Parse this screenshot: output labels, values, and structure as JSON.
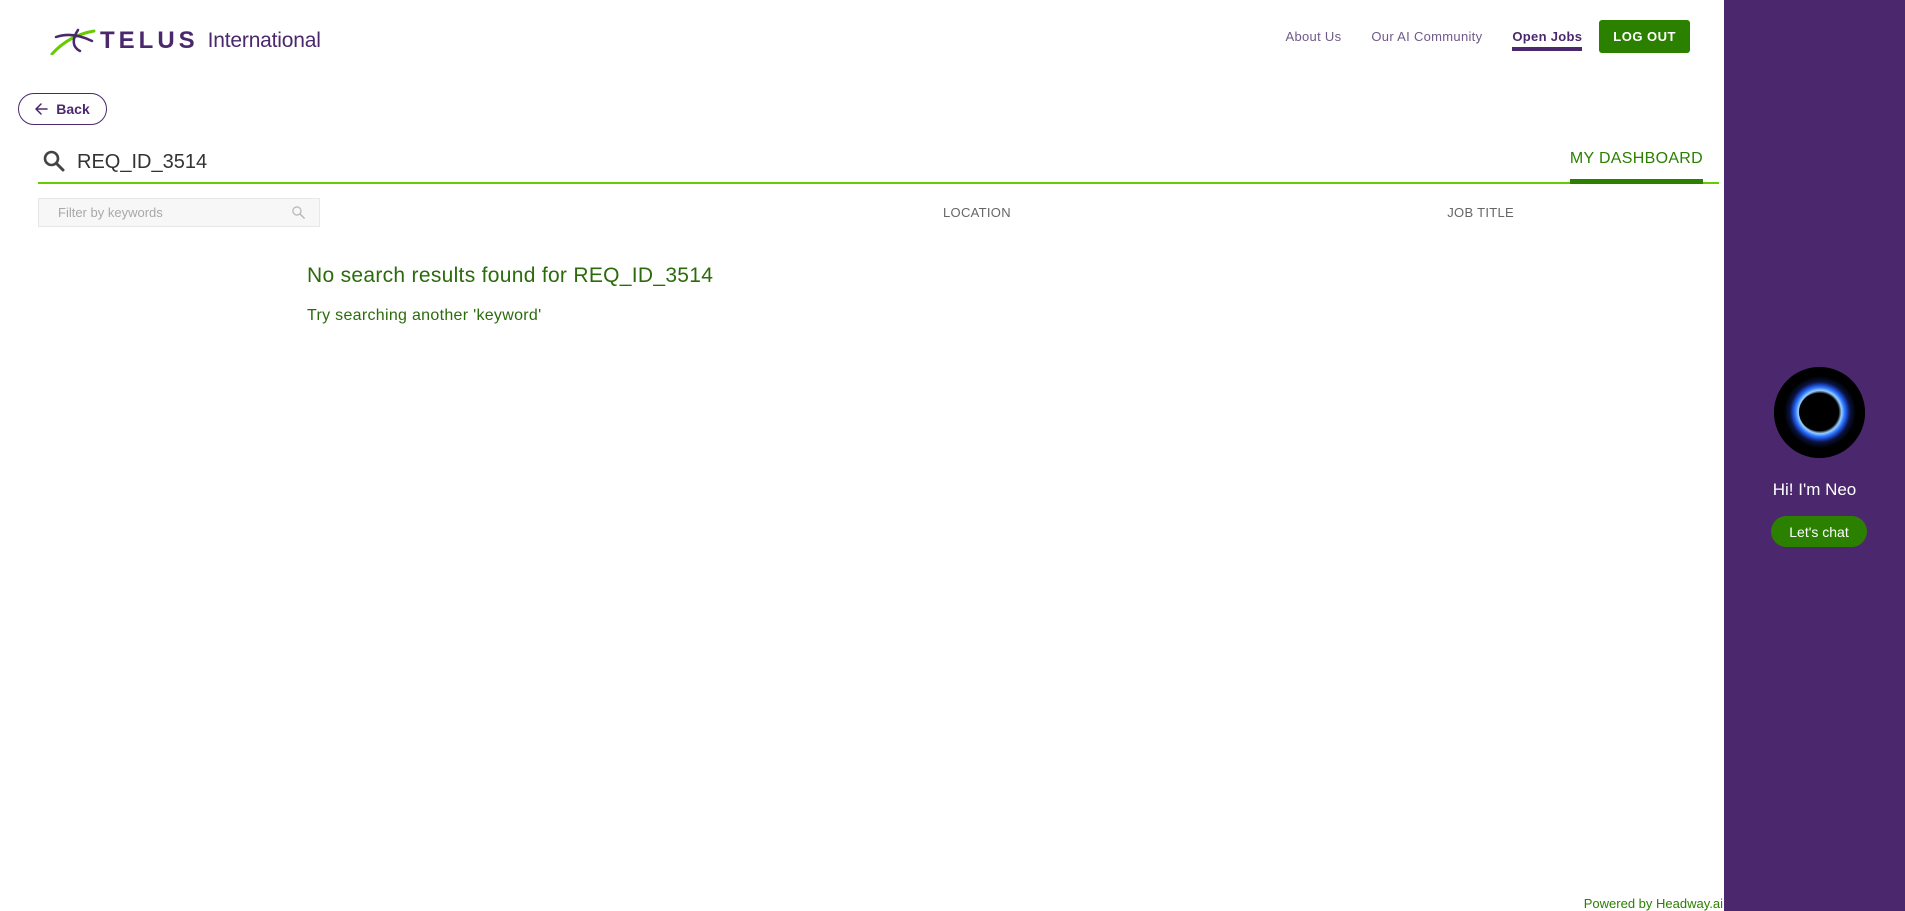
{
  "header": {
    "brand_name": "TELUS",
    "brand_sub": "International",
    "nav": {
      "about": "About Us",
      "community": "Our AI Community",
      "open_jobs": "Open Jobs",
      "logout": "LOG OUT"
    }
  },
  "back": {
    "label": "Back"
  },
  "search": {
    "value": "REQ_ID_3514",
    "tab_label": "MY DASHBOARD"
  },
  "filter": {
    "placeholder": "Filter by keywords",
    "location_col": "LOCATION",
    "job_title_col": "JOB TITLE"
  },
  "results": {
    "empty_title": "No search results found for REQ_ID_3514",
    "empty_hint": "Try searching another 'keyword'"
  },
  "footer": {
    "powered_by": "Powered by Headway.ai"
  },
  "chat_panel": {
    "greeting": "Hi! I'm Neo",
    "button_label": "Let's chat"
  },
  "colors": {
    "brand_purple": "#4b286d",
    "brand_green": "#2b8000",
    "accent_line": "#66cc00"
  },
  "icons": {
    "logo": "telus-logo-icon",
    "back": "arrow-left-icon",
    "search": "search-icon",
    "filter": "filter-search-icon",
    "avatar": "neo-avatar-icon"
  }
}
